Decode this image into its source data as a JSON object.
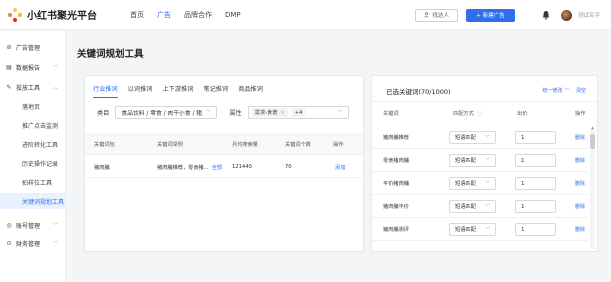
{
  "brand": {
    "name": "小红书聚光平台",
    "colors": {
      "accent": "#2f6fed",
      "logo": [
        "#ff7a45",
        "#ffb020",
        "#f5222d",
        "#ffc53d"
      ]
    }
  },
  "topnav": {
    "items": [
      {
        "label": "首页",
        "active": false
      },
      {
        "label": "广告",
        "active": true
      },
      {
        "label": "品牌合作",
        "active": false
      },
      {
        "label": "DMP",
        "active": false
      }
    ]
  },
  "header": {
    "find_label": "找达人",
    "find_icon": "person-search-icon",
    "new_ad_label": "+ 新建广告",
    "bell_icon": "bell-icon",
    "username": "测试名字"
  },
  "sidebar": {
    "items": [
      {
        "icon": "target-icon",
        "label": "广告管理",
        "expandable": false
      },
      {
        "icon": "chart-icon",
        "label": "数据报告",
        "expandable": true
      },
      {
        "icon": "tools-icon",
        "label": "投放工具",
        "expandable": true,
        "expanded": true
      }
    ],
    "sub_items": [
      {
        "label": "落地页",
        "active": false
      },
      {
        "label": "推广点击监测",
        "active": false
      },
      {
        "label": "进阶转化工具",
        "active": false
      },
      {
        "label": "历史操作记录",
        "active": false
      },
      {
        "label": "拍样位工具",
        "active": false
      },
      {
        "label": "关键词规划工具",
        "active": true
      }
    ],
    "bottom_items": [
      {
        "icon": "account-icon",
        "label": "账号管理",
        "expandable": true
      },
      {
        "icon": "finance-icon",
        "label": "财务管理",
        "expandable": true
      }
    ]
  },
  "page": {
    "title": "关键词规划工具"
  },
  "left_panel": {
    "tabs": [
      {
        "label": "行业推词",
        "active": true
      },
      {
        "label": "以词推词",
        "active": false
      },
      {
        "label": "上下游推词",
        "active": false
      },
      {
        "label": "笔记推词",
        "active": false
      },
      {
        "label": "商品推词",
        "active": false
      }
    ],
    "category_label": "类目",
    "category_value": "食品饮料 / 零食 / 肉干小食 / 猪",
    "attribute_label": "属性",
    "attribute_tag": "需求-食谱",
    "attribute_more": "+4",
    "columns": [
      "关键词包",
      "关键词举例",
      "月均搜索量",
      "关键词个数",
      "操作"
    ],
    "rows": [
      {
        "package": "猪肉脯",
        "examples": "猪肉脯推荐，零食猪...",
        "all_link": "全部",
        "monthly_search": "121440",
        "keyword_count": "70",
        "action": "添加"
      }
    ]
  },
  "right_panel": {
    "title": "已选关键词(70/1000)",
    "batch_modify": "统一修改",
    "clear": "清空",
    "columns": [
      "关键词",
      "匹配方式",
      "出价",
      "操作"
    ],
    "rows": [
      {
        "keyword": "猪肉脯推荐",
        "match": "短语匹配",
        "bid": "1",
        "action": "删除"
      },
      {
        "keyword": "零食猪肉脯",
        "match": "短语匹配",
        "bid": "1",
        "action": "删除"
      },
      {
        "keyword": "平价猪肉脯",
        "match": "短语匹配",
        "bid": "1",
        "action": "删除"
      },
      {
        "keyword": "猪肉脯平价",
        "match": "短语匹配",
        "bid": "1",
        "action": "删除"
      },
      {
        "keyword": "猪肉脯测评",
        "match": "短语匹配",
        "bid": "1",
        "action": "删除"
      }
    ]
  }
}
